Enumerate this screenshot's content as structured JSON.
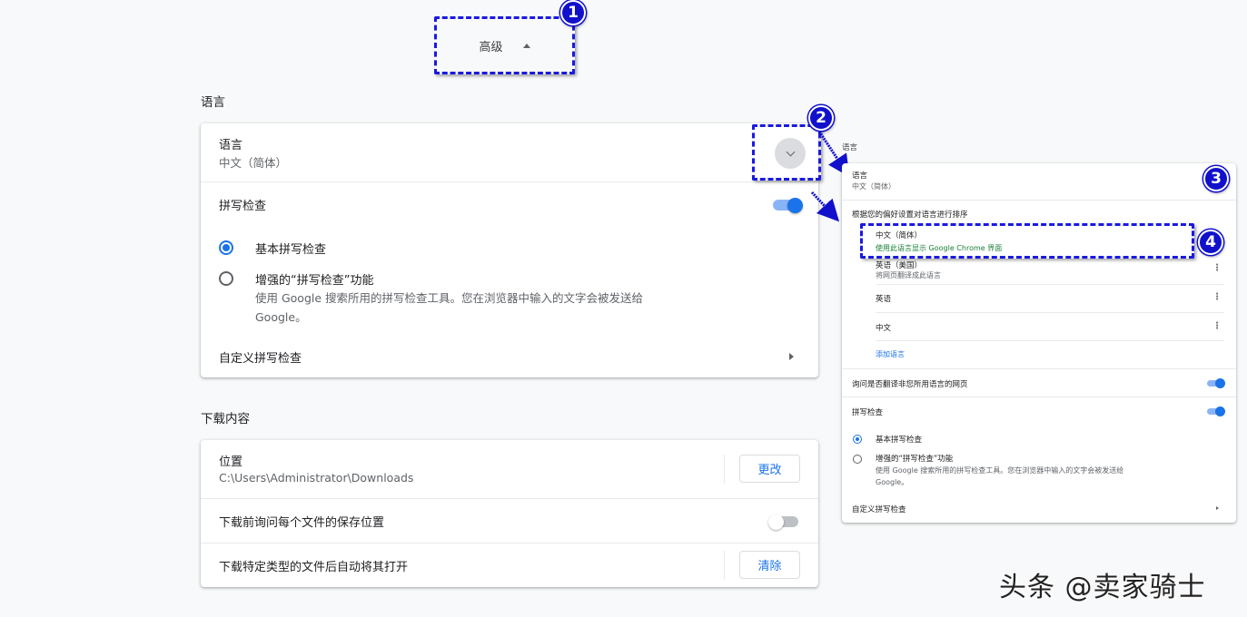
{
  "advanced": {
    "label": "高级"
  },
  "language_section": {
    "title": "语言",
    "language_row": {
      "label": "语言",
      "value": "中文（简体）"
    },
    "spell_check": {
      "label": "拼写检查",
      "enabled": true
    },
    "basic": {
      "label": "基本拼写检查",
      "selected": true
    },
    "enhanced": {
      "label": "增强的“拼写检查”功能",
      "desc": "使用 Google 搜索所用的拼写检查工具。您在浏览器中输入的文字会被发送给",
      "desc2": "Google。",
      "selected": false
    },
    "custom": {
      "label": "自定义拼写检查"
    }
  },
  "downloads_section": {
    "title": "下载内容",
    "location": {
      "label": "位置",
      "path": "C:\\Users\\Administrator\\Downloads",
      "button": "更改"
    },
    "ask": {
      "label": "下载前询问每个文件的保存位置",
      "enabled": false
    },
    "auto_open": {
      "label": "下载特定类型的文件后自动将其打开",
      "button": "清除"
    }
  },
  "expanded_panel": {
    "title": "语言",
    "language_row": {
      "label": "语言",
      "value": "中文（简体）"
    },
    "order_hint": "根据您的偏好设置对语言进行排序",
    "languages": [
      {
        "name": "中文（简体）",
        "note": "使用此语言显示 Google Chrome 界面"
      },
      {
        "name": "英语（美国）",
        "note": "将网页翻译成此语言"
      },
      {
        "name": "英语",
        "note": ""
      },
      {
        "name": "中文",
        "note": ""
      }
    ],
    "add_language": "添加语言",
    "offer_translate": {
      "label": "询问是否翻译非您所用语言的网页",
      "enabled": true
    },
    "spell_check": {
      "label": "拼写检查",
      "enabled": true
    },
    "basic": {
      "label": "基本拼写检查",
      "selected": true
    },
    "enhanced": {
      "label": "增强的“拼写检查”功能",
      "desc": "使用 Google 搜索所用的拼写检查工具。您在浏览器中输入的文字会被发送给",
      "desc2": "Google。",
      "selected": false
    },
    "custom": {
      "label": "自定义拼写检查"
    }
  },
  "badges": [
    "1",
    "2",
    "3",
    "4"
  ],
  "watermark": "头条 @卖家骑士",
  "colors": {
    "accent": "#1a73e8",
    "annotation": "#1a1ae0",
    "green": "#188038"
  }
}
